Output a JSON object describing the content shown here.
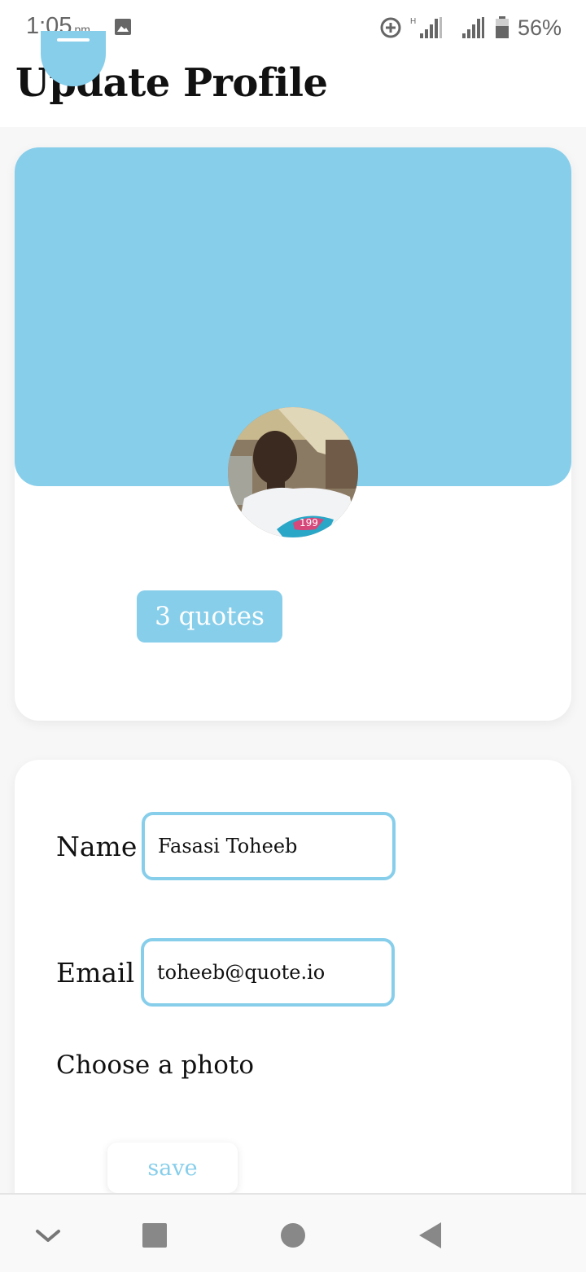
{
  "status_bar": {
    "time": "1:05",
    "ampm": "pm",
    "battery": "56%"
  },
  "header": {
    "title": "Update Profile"
  },
  "profile": {
    "quotes_count": "3 quotes",
    "accent_color": "#87ceeb"
  },
  "form": {
    "name_label": "Name",
    "name_value": "Fasasi Toheeb",
    "email_label": "Email",
    "email_value": "toheeb@quote.io",
    "photo_label": "Choose a photo",
    "save_label": "save"
  },
  "nav": {
    "icons": [
      "chevron-down-icon",
      "square-icon",
      "circle-icon",
      "back-triangle-icon"
    ]
  }
}
